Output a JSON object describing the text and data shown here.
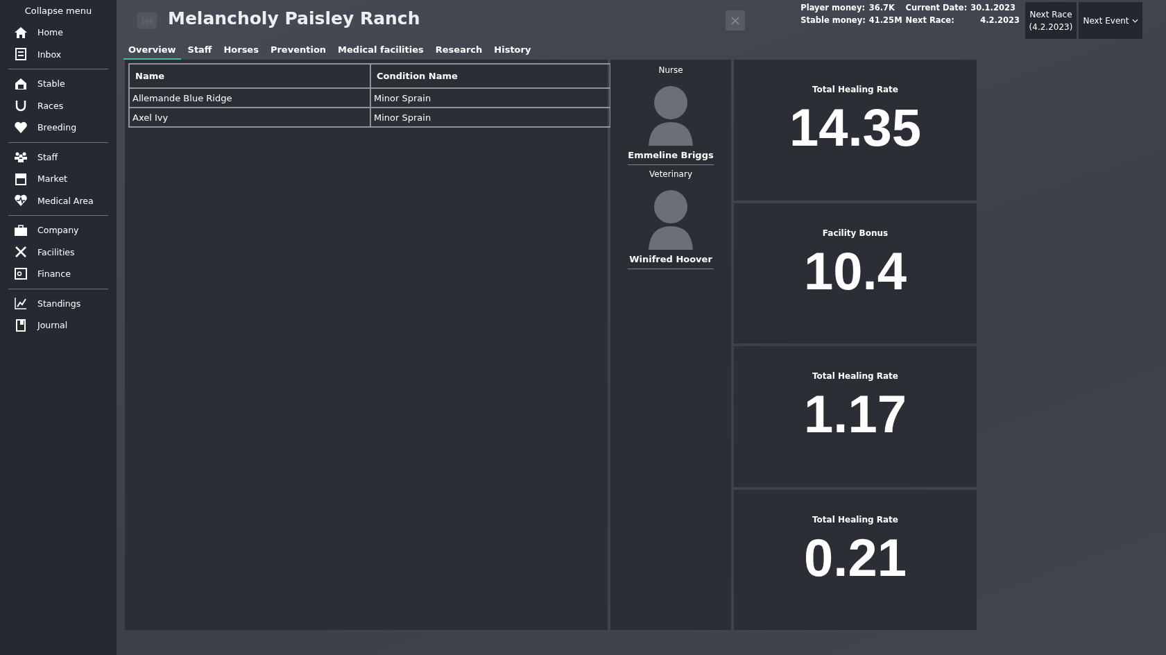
{
  "sidebar": {
    "collapse_label": "Collapse menu",
    "groups": [
      [
        {
          "label": "Home"
        },
        {
          "label": "Inbox"
        }
      ],
      [
        {
          "label": "Stable"
        },
        {
          "label": "Races"
        },
        {
          "label": "Breeding"
        }
      ],
      [
        {
          "label": "Staff"
        },
        {
          "label": "Market"
        },
        {
          "label": "Medical Area"
        }
      ],
      [
        {
          "label": "Company"
        },
        {
          "label": "Facilities"
        },
        {
          "label": "Finance"
        }
      ],
      [
        {
          "label": "Standings"
        },
        {
          "label": "Journal"
        }
      ]
    ]
  },
  "header": {
    "title": "Melancholy Paisley Ranch"
  },
  "status": {
    "player_money_label": "Player money:",
    "player_money": "36.7K",
    "current_date_label": "Current Date:",
    "current_date": "30.1.2023",
    "stable_money_label": "Stable money:",
    "stable_money": "41.25M",
    "next_race_label": "Next Race:",
    "next_race": "4.2.2023"
  },
  "next_race_button": {
    "line1": "Next Race",
    "line2": "(4.2.2023)"
  },
  "next_event_button": {
    "label": "Next Event"
  },
  "tabs": [
    {
      "label": "Overview",
      "selected": true
    },
    {
      "label": "Staff",
      "selected": false
    },
    {
      "label": "Horses",
      "selected": false
    },
    {
      "label": "Prevention",
      "selected": false
    },
    {
      "label": "Medical facilities",
      "selected": false
    },
    {
      "label": "Research",
      "selected": false
    },
    {
      "label": "History",
      "selected": false
    }
  ],
  "table": {
    "columns": [
      "Name",
      "Condition Name"
    ],
    "rows": [
      [
        "Allemande Blue Ridge",
        "Minor Sprain"
      ],
      [
        "Axel Ivy",
        "Minor Sprain"
      ]
    ]
  },
  "staff": [
    {
      "role": "Nurse",
      "name": "Emmeline Briggs"
    },
    {
      "role": "Veterinary",
      "name": "Winifred Hoover"
    }
  ],
  "stats": [
    {
      "label": "Total Healing Rate",
      "value": "14.35"
    },
    {
      "label": "Facility Bonus",
      "value": "10.4"
    },
    {
      "label": "Total Healing Rate",
      "value": "1.17"
    },
    {
      "label": "Total Healing Rate",
      "value": "0.21"
    }
  ]
}
